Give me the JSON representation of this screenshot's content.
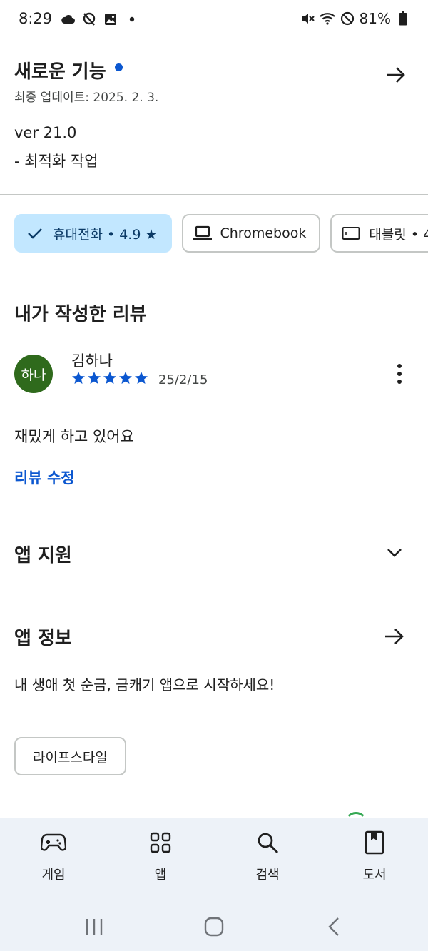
{
  "status_bar": {
    "time": "8:29",
    "battery": "81%",
    "left_icons": [
      "cloud-icon",
      "location-off-icon",
      "image-icon",
      "dot-icon"
    ],
    "right_icons": [
      "mute-icon",
      "wifi-icon",
      "do-not-disturb-icon",
      "battery-icon"
    ]
  },
  "whats_new": {
    "title": "새로운 기능",
    "updated": "최종 업데이트: 2025. 2. 3.",
    "version": "ver 21.0",
    "note": "- 최적화 작업"
  },
  "device_chips": [
    {
      "label": "휴대전화 • 4.9 ★",
      "icon": "check-icon",
      "selected": true
    },
    {
      "label": "Chromebook",
      "icon": "laptop-icon",
      "selected": false
    },
    {
      "label": "태블릿 • 4",
      "icon": "tablet-icon",
      "selected": false
    }
  ],
  "my_review": {
    "title": "내가 작성한 리뷰",
    "avatar_text": "하나",
    "name": "김하나",
    "rating": 5,
    "date": "25/2/15",
    "text": "재밌게 하고 있어요",
    "edit_label": "리뷰 수정"
  },
  "app_support": {
    "title": "앱 지원"
  },
  "app_info": {
    "title": "앱 정보",
    "description": "내 생애 첫 순금, 금캐기 앱으로 시작하세요!",
    "category": "라이프스타일"
  },
  "bottom_nav": {
    "items": [
      {
        "label": "게임",
        "icon": "gamepad-icon"
      },
      {
        "label": "앱",
        "icon": "apps-grid-icon"
      },
      {
        "label": "검색",
        "icon": "search-icon"
      },
      {
        "label": "도서",
        "icon": "book-icon"
      }
    ]
  },
  "colors": {
    "accent": "#0b57d0",
    "chip_selected": "#c2e7ff",
    "avatar": "#2f6a1c",
    "nav_bg": "#edf2f8"
  }
}
